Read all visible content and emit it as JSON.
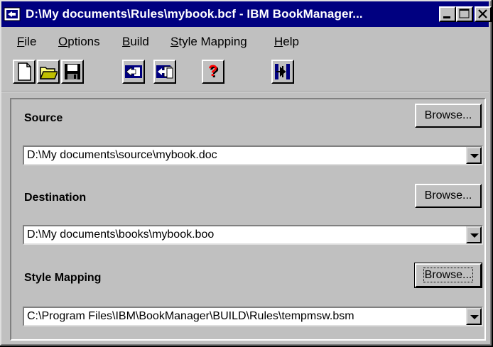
{
  "window": {
    "title": "D:\\My documents\\Rules\\mybook.bcf - IBM BookManager..."
  },
  "menu": [
    "File",
    "Options",
    "Build",
    "Style Mapping",
    "Help"
  ],
  "toolbar": {
    "icons": [
      "new-document-icon",
      "open-folder-icon",
      "save-disk-icon",
      "back-arrow-icon",
      "copy-pages-icon",
      "help-question-icon",
      "run-build-icon"
    ]
  },
  "sections": {
    "source": {
      "label": "Source",
      "browse": "Browse...",
      "value": "D:\\My documents\\source\\mybook.doc"
    },
    "destination": {
      "label": "Destination",
      "browse": "Browse...",
      "value": "D:\\My documents\\books\\mybook.boo"
    },
    "style_mapping": {
      "label": "Style Mapping",
      "browse": "Browse...",
      "value": "C:\\Program Files\\IBM\\BookManager\\BUILD\\Rules\\tempmsw.bsm"
    }
  },
  "colors": {
    "titlebar": "#000080",
    "face": "#c0c0c0"
  }
}
